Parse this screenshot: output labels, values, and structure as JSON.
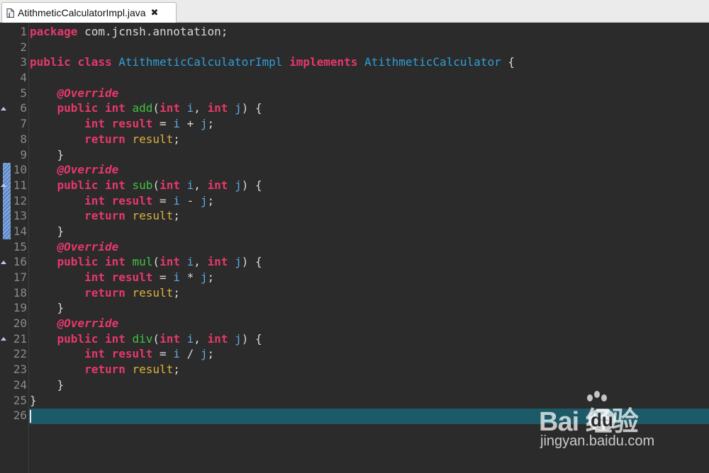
{
  "tab": {
    "title": "AtithmeticCalculatorImpl.java",
    "close_glyph": "✖"
  },
  "editor": {
    "line_numbers": [
      "1",
      "2",
      "3",
      "4",
      "5",
      "6",
      "7",
      "8",
      "9",
      "10",
      "11",
      "12",
      "13",
      "14",
      "15",
      "16",
      "17",
      "18",
      "19",
      "20",
      "21",
      "22",
      "23",
      "24",
      "25",
      "26"
    ],
    "current_line": 26,
    "lines": [
      [
        {
          "t": "kw",
          "v": "package"
        },
        {
          "t": "plain",
          "v": " com.jcnsh.annotation;"
        }
      ],
      [],
      [
        {
          "t": "kw",
          "v": "public"
        },
        {
          "t": "plain",
          "v": " "
        },
        {
          "t": "kw",
          "v": "class"
        },
        {
          "t": "plain",
          "v": " "
        },
        {
          "t": "cls",
          "v": "AtithmeticCalculatorImpl"
        },
        {
          "t": "plain",
          "v": " "
        },
        {
          "t": "kw",
          "v": "implements"
        },
        {
          "t": "plain",
          "v": " "
        },
        {
          "t": "cls",
          "v": "AtithmeticCalculator"
        },
        {
          "t": "plain",
          "v": " {"
        }
      ],
      [],
      [
        {
          "t": "plain",
          "v": "    "
        },
        {
          "t": "anno",
          "v": "@Override"
        }
      ],
      [
        {
          "t": "plain",
          "v": "    "
        },
        {
          "t": "kw",
          "v": "public"
        },
        {
          "t": "plain",
          "v": " "
        },
        {
          "t": "kw",
          "v": "int"
        },
        {
          "t": "plain",
          "v": " "
        },
        {
          "t": "fn",
          "v": "add"
        },
        {
          "t": "plain",
          "v": "("
        },
        {
          "t": "kw",
          "v": "int"
        },
        {
          "t": "plain",
          "v": " "
        },
        {
          "t": "prm",
          "v": "i"
        },
        {
          "t": "plain",
          "v": ", "
        },
        {
          "t": "kw",
          "v": "int"
        },
        {
          "t": "plain",
          "v": " "
        },
        {
          "t": "prm",
          "v": "j"
        },
        {
          "t": "plain",
          "v": ") {"
        }
      ],
      [
        {
          "t": "plain",
          "v": "        "
        },
        {
          "t": "kw",
          "v": "int"
        },
        {
          "t": "plain",
          "v": " "
        },
        {
          "t": "kw",
          "v": "result"
        },
        {
          "t": "plain",
          "v": " = "
        },
        {
          "t": "prm",
          "v": "i"
        },
        {
          "t": "plain",
          "v": " + "
        },
        {
          "t": "prm",
          "v": "j"
        },
        {
          "t": "plain",
          "v": ";"
        }
      ],
      [
        {
          "t": "plain",
          "v": "        "
        },
        {
          "t": "kw",
          "v": "return"
        },
        {
          "t": "plain",
          "v": " "
        },
        {
          "t": "var",
          "v": "result"
        },
        {
          "t": "plain",
          "v": ";"
        }
      ],
      [
        {
          "t": "plain",
          "v": "    }"
        }
      ],
      [
        {
          "t": "plain",
          "v": "    "
        },
        {
          "t": "anno",
          "v": "@Override"
        }
      ],
      [
        {
          "t": "plain",
          "v": "    "
        },
        {
          "t": "kw",
          "v": "public"
        },
        {
          "t": "plain",
          "v": " "
        },
        {
          "t": "kw",
          "v": "int"
        },
        {
          "t": "plain",
          "v": " "
        },
        {
          "t": "fn",
          "v": "sub"
        },
        {
          "t": "plain",
          "v": "("
        },
        {
          "t": "kw",
          "v": "int"
        },
        {
          "t": "plain",
          "v": " "
        },
        {
          "t": "prm",
          "v": "i"
        },
        {
          "t": "plain",
          "v": ", "
        },
        {
          "t": "kw",
          "v": "int"
        },
        {
          "t": "plain",
          "v": " "
        },
        {
          "t": "prm",
          "v": "j"
        },
        {
          "t": "plain",
          "v": ") {"
        }
      ],
      [
        {
          "t": "plain",
          "v": "        "
        },
        {
          "t": "kw",
          "v": "int"
        },
        {
          "t": "plain",
          "v": " "
        },
        {
          "t": "kw",
          "v": "result"
        },
        {
          "t": "plain",
          "v": " = "
        },
        {
          "t": "prm",
          "v": "i"
        },
        {
          "t": "plain",
          "v": " - "
        },
        {
          "t": "prm",
          "v": "j"
        },
        {
          "t": "plain",
          "v": ";"
        }
      ],
      [
        {
          "t": "plain",
          "v": "        "
        },
        {
          "t": "kw",
          "v": "return"
        },
        {
          "t": "plain",
          "v": " "
        },
        {
          "t": "var",
          "v": "result"
        },
        {
          "t": "plain",
          "v": ";"
        }
      ],
      [
        {
          "t": "plain",
          "v": "    }"
        }
      ],
      [
        {
          "t": "plain",
          "v": "    "
        },
        {
          "t": "anno",
          "v": "@Override"
        }
      ],
      [
        {
          "t": "plain",
          "v": "    "
        },
        {
          "t": "kw",
          "v": "public"
        },
        {
          "t": "plain",
          "v": " "
        },
        {
          "t": "kw",
          "v": "int"
        },
        {
          "t": "plain",
          "v": " "
        },
        {
          "t": "fn",
          "v": "mul"
        },
        {
          "t": "plain",
          "v": "("
        },
        {
          "t": "kw",
          "v": "int"
        },
        {
          "t": "plain",
          "v": " "
        },
        {
          "t": "prm",
          "v": "i"
        },
        {
          "t": "plain",
          "v": ", "
        },
        {
          "t": "kw",
          "v": "int"
        },
        {
          "t": "plain",
          "v": " "
        },
        {
          "t": "prm",
          "v": "j"
        },
        {
          "t": "plain",
          "v": ") {"
        }
      ],
      [
        {
          "t": "plain",
          "v": "        "
        },
        {
          "t": "kw",
          "v": "int"
        },
        {
          "t": "plain",
          "v": " "
        },
        {
          "t": "kw",
          "v": "result"
        },
        {
          "t": "plain",
          "v": " = "
        },
        {
          "t": "prm",
          "v": "i"
        },
        {
          "t": "plain",
          "v": " * "
        },
        {
          "t": "prm",
          "v": "j"
        },
        {
          "t": "plain",
          "v": ";"
        }
      ],
      [
        {
          "t": "plain",
          "v": "        "
        },
        {
          "t": "kw",
          "v": "return"
        },
        {
          "t": "plain",
          "v": " "
        },
        {
          "t": "var",
          "v": "result"
        },
        {
          "t": "plain",
          "v": ";"
        }
      ],
      [
        {
          "t": "plain",
          "v": "    }"
        }
      ],
      [
        {
          "t": "plain",
          "v": "    "
        },
        {
          "t": "anno",
          "v": "@Override"
        }
      ],
      [
        {
          "t": "plain",
          "v": "    "
        },
        {
          "t": "kw",
          "v": "public"
        },
        {
          "t": "plain",
          "v": " "
        },
        {
          "t": "kw",
          "v": "int"
        },
        {
          "t": "plain",
          "v": " "
        },
        {
          "t": "fn",
          "v": "div"
        },
        {
          "t": "plain",
          "v": "("
        },
        {
          "t": "kw",
          "v": "int"
        },
        {
          "t": "plain",
          "v": " "
        },
        {
          "t": "prm",
          "v": "i"
        },
        {
          "t": "plain",
          "v": ", "
        },
        {
          "t": "kw",
          "v": "int"
        },
        {
          "t": "plain",
          "v": " "
        },
        {
          "t": "prm",
          "v": "j"
        },
        {
          "t": "plain",
          "v": ") {"
        }
      ],
      [
        {
          "t": "plain",
          "v": "        "
        },
        {
          "t": "kw",
          "v": "int"
        },
        {
          "t": "plain",
          "v": " "
        },
        {
          "t": "kw",
          "v": "result"
        },
        {
          "t": "plain",
          "v": " = "
        },
        {
          "t": "prm",
          "v": "i"
        },
        {
          "t": "plain",
          "v": " / "
        },
        {
          "t": "prm",
          "v": "j"
        },
        {
          "t": "plain",
          "v": ";"
        }
      ],
      [
        {
          "t": "plain",
          "v": "        "
        },
        {
          "t": "kw",
          "v": "return"
        },
        {
          "t": "plain",
          "v": " "
        },
        {
          "t": "var",
          "v": "result"
        },
        {
          "t": "plain",
          "v": ";"
        }
      ],
      [
        {
          "t": "plain",
          "v": "    }"
        }
      ],
      [
        {
          "t": "plain",
          "v": "}"
        }
      ],
      []
    ],
    "override_marker_lines": [
      6,
      11,
      16,
      21
    ],
    "colors": {
      "background": "#2b2b2b",
      "keyword": "#e6386b",
      "class_name": "#2f9fd8",
      "method_name": "#3fc23f",
      "parameter": "#5ea8e0",
      "local_variable": "#d9b23a",
      "plain": "#d9d9d9",
      "current_line": "#1d5a68",
      "line_number": "#8a8a8a"
    }
  },
  "watermark": {
    "logo_text": "Bai  经验",
    "logo_du": "du",
    "url": "jingyan.baidu.com"
  }
}
